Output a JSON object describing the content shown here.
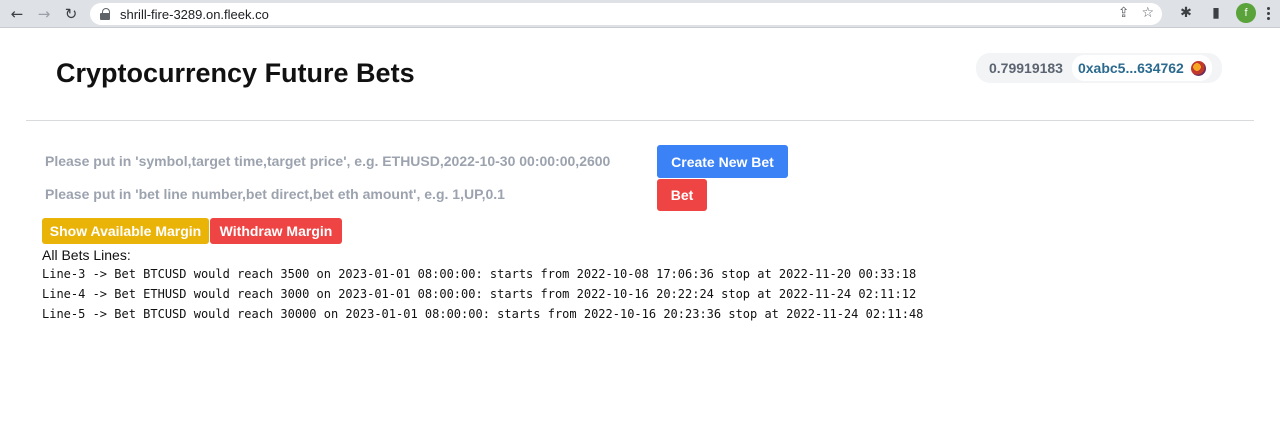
{
  "browser": {
    "url": "shrill-fire-3289.on.fleek.co",
    "profile_initial": "f"
  },
  "header": {
    "title": "Cryptocurrency Future Bets",
    "wallet": {
      "balance": "0.79919183",
      "address": "0xabc5...634762"
    }
  },
  "form": {
    "new_bet_placeholder": "Please put in 'symbol,target time,target price', e.g. ETHUSD,2022-10-30 00:00:00,2600",
    "create_button": "Create New Bet",
    "bet_placeholder": "Please put in 'bet line number,bet direct,bet eth amount', e.g. 1,UP,0.1",
    "bet_button": "Bet"
  },
  "margin": {
    "show_button": "Show Available Margin",
    "withdraw_button": "Withdraw Margin"
  },
  "bets": {
    "heading": "All Bets Lines:",
    "lines": [
      "Line-3 -> Bet BTCUSD would reach 3500 on 2023-01-01 08:00:00: starts from 2022-10-08 17:06:36 stop at 2022-11-20 00:33:18",
      "Line-4 -> Bet ETHUSD would reach 3000 on 2023-01-01 08:00:00: starts from 2022-10-16 20:22:24 stop at 2022-11-24 02:11:12",
      "Line-5 -> Bet BTCUSD would reach 30000 on 2023-01-01 08:00:00: starts from 2022-10-16 20:23:36 stop at 2022-11-24 02:11:48"
    ]
  },
  "colors": {
    "primary": "#3b82f6",
    "danger": "#ef4444",
    "warning": "#eab308"
  }
}
